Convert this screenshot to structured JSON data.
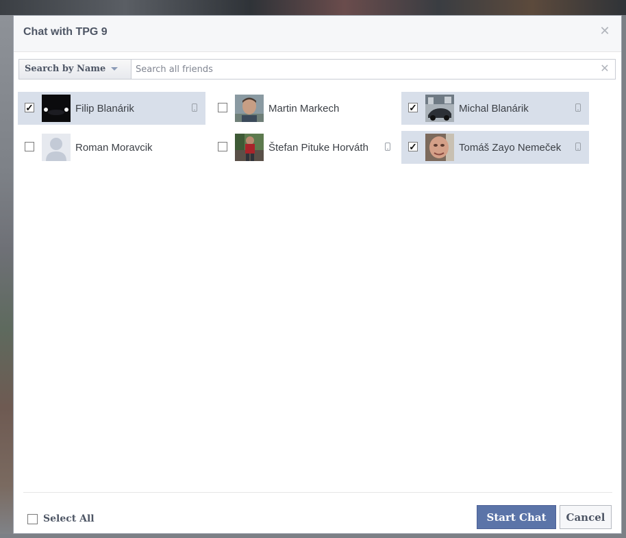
{
  "dialog": {
    "title": "Chat with TPG 9",
    "close_icon": "close-icon"
  },
  "search": {
    "mode_label": "Search by Name",
    "placeholder": "Search all friends",
    "value": ""
  },
  "friends": [
    {
      "name": "Filip Blanárik",
      "selected": true,
      "mobile": true
    },
    {
      "name": "Martin Markech",
      "selected": false,
      "mobile": false
    },
    {
      "name": "Michal Blanárik",
      "selected": true,
      "mobile": true
    },
    {
      "name": "Roman Moravcik",
      "selected": false,
      "mobile": false
    },
    {
      "name": "Štefan Pituke Horváth",
      "selected": false,
      "mobile": true
    },
    {
      "name": "Tomáš Zayo Nemeček",
      "selected": true,
      "mobile": true
    }
  ],
  "footer": {
    "select_all_label": "Select All",
    "start_chat_label": "Start Chat",
    "cancel_label": "Cancel"
  },
  "colors": {
    "selected_row": "#d8dfea",
    "primary_button": "#5b74a8"
  }
}
